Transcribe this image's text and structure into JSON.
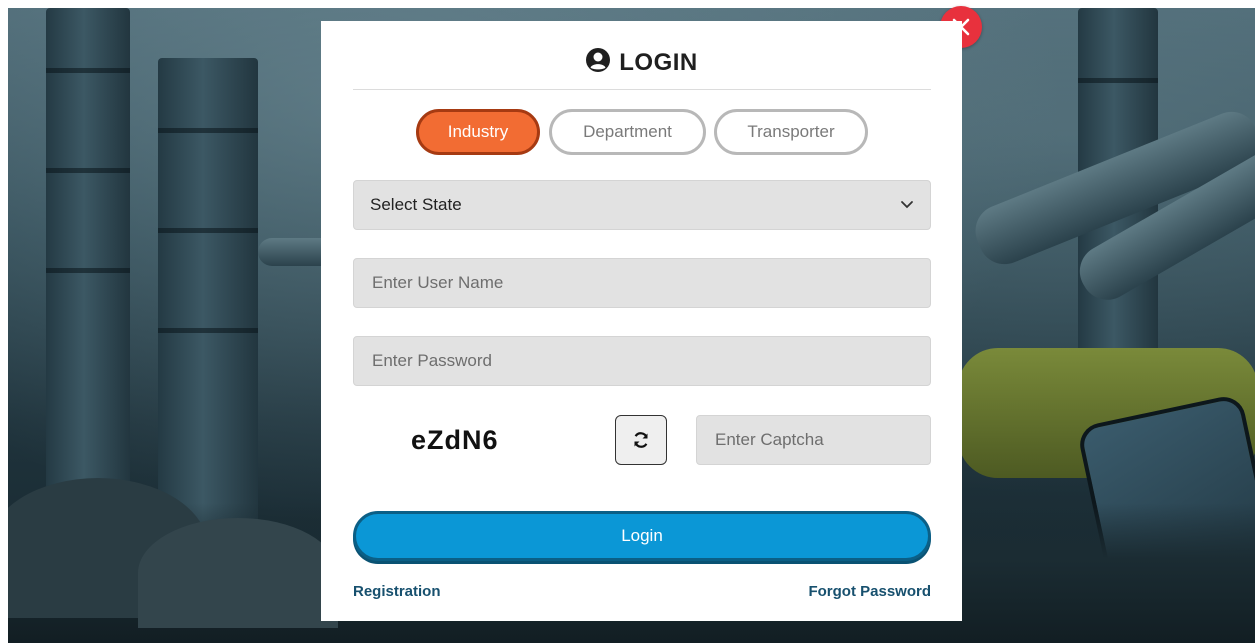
{
  "modal": {
    "title": "LOGIN",
    "tabs": [
      {
        "label": "Industry",
        "active": true
      },
      {
        "label": "Department",
        "active": false
      },
      {
        "label": "Transporter",
        "active": false
      }
    ],
    "state_select": {
      "selected": "Select State"
    },
    "username": {
      "placeholder": "Enter User Name",
      "value": ""
    },
    "password": {
      "placeholder": "Enter Password",
      "value": ""
    },
    "captcha": {
      "code": "eZdN6",
      "placeholder": "Enter Captcha",
      "value": ""
    },
    "login_label": "Login",
    "registration_label": "Registration",
    "forgot_password_label": "Forgot Password"
  },
  "colors": {
    "active_tab": "#f26c33",
    "login_button": "#0b97d6",
    "close_button": "#e8313d",
    "link": "#17506e"
  },
  "icons": [
    "close-icon",
    "user-circle-icon",
    "chevron-down-icon",
    "refresh-icon"
  ]
}
